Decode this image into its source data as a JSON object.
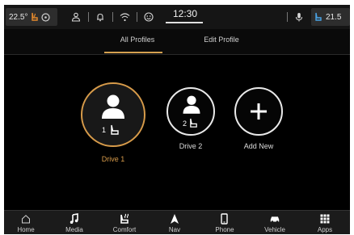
{
  "status_bar": {
    "driver_temp": "22.5°",
    "passenger_temp": "21.5",
    "clock": "12:30"
  },
  "tabs": [
    {
      "label": "All Profiles",
      "active": true
    },
    {
      "label": "Edit Profile",
      "active": false
    }
  ],
  "profiles": [
    {
      "label": "Drive 1",
      "slot": "1",
      "selected": true
    },
    {
      "label": "Drive 2",
      "slot": "2",
      "selected": false
    },
    {
      "label": "Add New"
    }
  ],
  "nav": [
    {
      "label": "Home",
      "icon": "home-icon"
    },
    {
      "label": "Media",
      "icon": "music-note-icon"
    },
    {
      "label": "Comfort",
      "icon": "heated-seat-icon"
    },
    {
      "label": "Nav",
      "icon": "navigation-arrow-icon"
    },
    {
      "label": "Phone",
      "icon": "phone-icon"
    },
    {
      "label": "Vehicle",
      "icon": "car-icon"
    },
    {
      "label": "Apps",
      "icon": "apps-grid-icon"
    }
  ],
  "colors": {
    "accent": "#d79b4a",
    "background": "#000000",
    "bar": "#1b1b1b"
  }
}
